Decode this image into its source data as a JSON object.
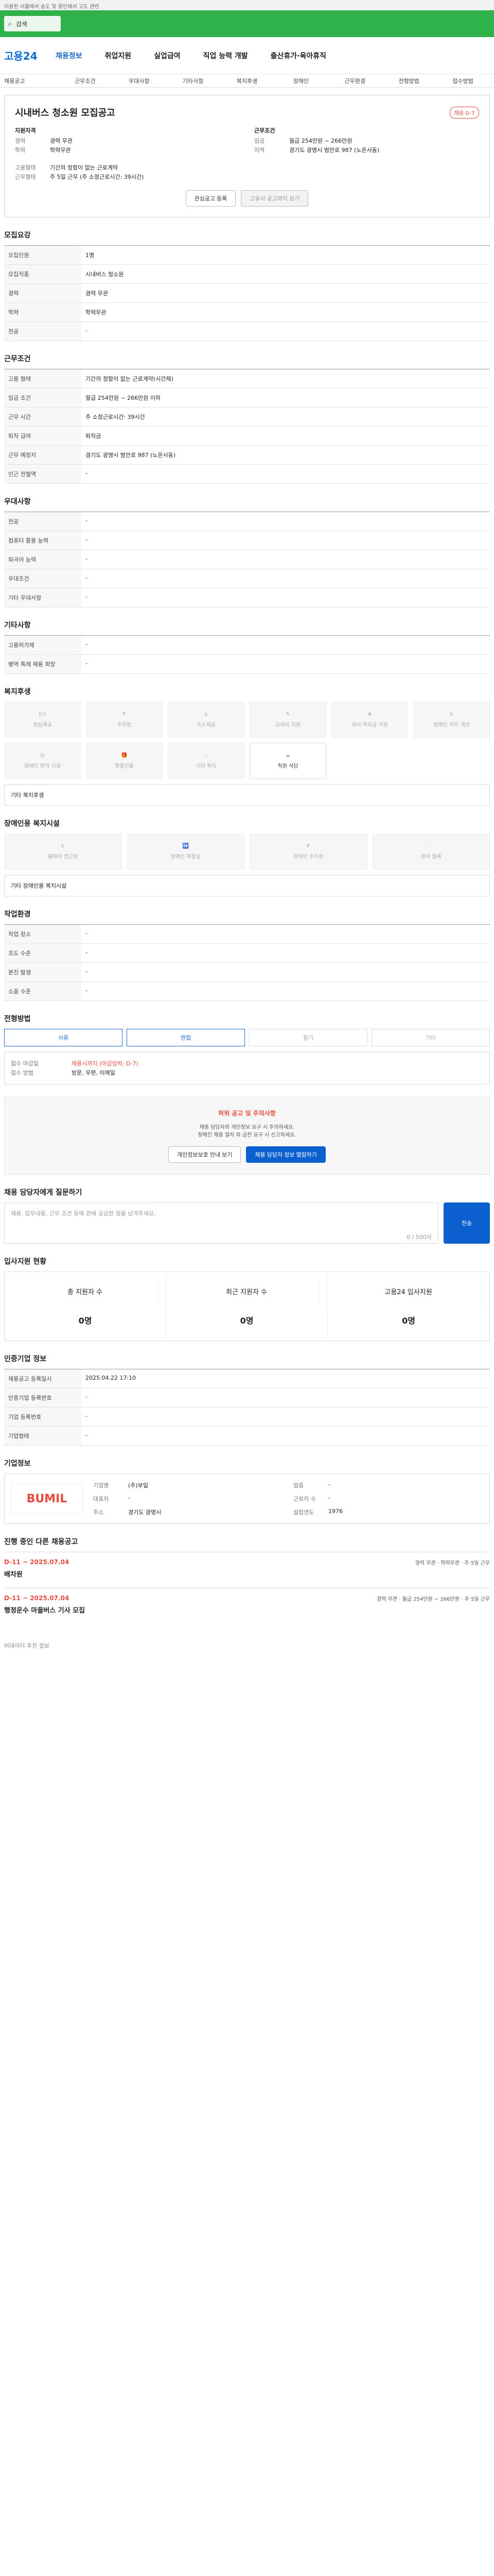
{
  "topbar": {
    "text": "이용된 서울에서 송도 및 용인에서 고도 관련"
  },
  "search": {
    "placeholder": "검색"
  },
  "header": {
    "logo": "고용24",
    "nav": [
      "채용정보",
      "취업지원",
      "실업급여",
      "직업 능력 개발",
      "출산휴가·육아휴직"
    ]
  },
  "subnav": [
    "채용공고",
    "근무조건",
    "우대사항",
    "기타사항",
    "복지후생",
    "장애인",
    "근무환경",
    "전형방법",
    "접수방법"
  ],
  "job": {
    "title": "시내버스 청소원 모집공고",
    "badge": "채용 D-7",
    "summary": {
      "left_label": "지원자격",
      "right_label": "근무조건",
      "rows": [
        {
          "k": "경력",
          "v": "경력 무관"
        },
        {
          "k": "학력",
          "v": "학력무관"
        },
        {
          "k": "임금",
          "v": "월급 254만원 ~ 266만원"
        },
        {
          "k": "지역",
          "v": "경기도 광명시 범안로 987 (노온사동)"
        },
        {
          "k": "고용형태",
          "v": "기간의 정함이 없는 근로계약"
        },
        {
          "k": "근무형태",
          "v": "주 5일 근무 (주 소정근로시간: 39시간)"
        }
      ]
    },
    "actions": [
      "관심공고 등록",
      "고유사 공고까지 보기"
    ]
  },
  "recruit": {
    "title": "모집요강",
    "rows": [
      {
        "k": "모집인원",
        "v": "1명"
      },
      {
        "k": "모집직종",
        "v": "시내버스 청소원"
      },
      {
        "k": "경력",
        "v": "경력 무관"
      },
      {
        "k": "학력",
        "v": "학력무관"
      },
      {
        "k": "전공",
        "v": "-"
      }
    ]
  },
  "work": {
    "title": "근무조건",
    "rows": [
      {
        "k": "고용 형태",
        "v": "기간의 정함이 없는 근로계약(시간제)"
      },
      {
        "k": "임금 조건",
        "v": "월급 254만원 ~ 266만원 이하"
      },
      {
        "k": "근무 시간",
        "v": "주 소정근로시간: 39시간"
      },
      {
        "k": "퇴직 급여",
        "v": "퇴직금"
      },
      {
        "k": "근무 예정지",
        "v": "경기도 광명시 범안로 987 (노온사동)"
      },
      {
        "k": "인근 전철역",
        "v": "-"
      }
    ]
  },
  "pref": {
    "title": "우대사항",
    "rows": [
      {
        "k": "전공",
        "v": "-"
      },
      {
        "k": "컴퓨터 활용 능력",
        "v": "-"
      },
      {
        "k": "외국어 능력",
        "v": "-"
      },
      {
        "k": "우대조건",
        "v": "-"
      },
      {
        "k": "기타 우대사항",
        "v": "-"
      }
    ]
  },
  "etc": {
    "title": "기타사항",
    "rows": [
      {
        "k": "고용허가제",
        "v": "-"
      },
      {
        "k": "병역 특례 채용 희망",
        "v": "-"
      }
    ]
  },
  "welfare": {
    "title": "복지후생",
    "items": [
      "점심제공",
      "주차장",
      "숙소제공",
      "교육비 지원",
      "자녀 학자금 지원",
      "장애인 처우 개선",
      "장애인 편의 시설",
      "명절선물",
      "기타 복지",
      "직원 식당"
    ],
    "note": "기타 복지후생"
  },
  "disability": {
    "title": "장애인용 복지시설",
    "items": [
      "휠체어 접근성",
      "장애인 화장실",
      "장애인 주차장",
      "점자 블록"
    ],
    "note": "기타 장애인용 복지시설"
  },
  "env": {
    "title": "작업환경",
    "rows": [
      {
        "k": "작업 장소",
        "v": "-"
      },
      {
        "k": "조도 수준",
        "v": "-"
      },
      {
        "k": "분진 발생",
        "v": "-"
      },
      {
        "k": "소음 수준",
        "v": "-"
      }
    ]
  },
  "method": {
    "title": "전형방법",
    "tabs": [
      "서류",
      "면접",
      "필기",
      "기타"
    ]
  },
  "apply": {
    "title": "접수방법",
    "deadline_label": "접수 마감일",
    "deadline": "채용시까지 (마감임박: D-7)",
    "method_label": "접수 방법",
    "method": "방문, 우편, 이메일"
  },
  "alert": {
    "title": "허위 공고 및 주의사항",
    "lines": [
      "채용 담당자와 개인정보 요구 시 주의하세요.",
      "정해진 채용 절차 외 금전 요구 시 신고하세요."
    ],
    "buttons": [
      "개인정보보호 안내 보기",
      "채용 담당자 정보 열람하기"
    ]
  },
  "contact": {
    "title": "채용 담당자에게 질문하기",
    "placeholder": "채용, 업무내용, 근무 조건 등에 관해 궁금한 점을 남겨주세요.",
    "counter": "0 / 500자",
    "submit": "전송"
  },
  "stats": {
    "title": "입사지원 현황",
    "items": [
      {
        "label": "총 지원자 수",
        "value": "0명"
      },
      {
        "label": "최근 지원자 수",
        "value": "0명"
      },
      {
        "label": "고용24 입사지원",
        "value": "0명"
      }
    ]
  },
  "info": {
    "title": "인증기업 정보",
    "rows": [
      {
        "k": "채용공고 등록일시",
        "v": "2025.04.22 17:10"
      },
      {
        "k": "인증기업 등록번호",
        "v": "-"
      },
      {
        "k": "기업 등록번호",
        "v": "-"
      },
      {
        "k": "기업형태",
        "v": "-"
      }
    ]
  },
  "company": {
    "title": "기업정보",
    "logo": "BUMIL",
    "rows": [
      {
        "k": "기업명",
        "v": "(주)부일"
      },
      {
        "k": "업종",
        "v": "-"
      },
      {
        "k": "대표자",
        "v": "-"
      },
      {
        "k": "근로자 수",
        "v": "-"
      },
      {
        "k": "주소",
        "v": "경기도 광명시"
      },
      {
        "k": "설립연도",
        "v": "1976"
      }
    ]
  },
  "related": {
    "title": "진행 중인 다른 채용공고",
    "jobs": [
      {
        "d": "D-11 ~ 2025.07.04",
        "title": "배차원",
        "tags": "경력 무관 · 학력무관 · 주 5일 근무"
      },
      {
        "d": "D-11 ~ 2025.07.04",
        "title": "행정운수 마을버스 기사 모집",
        "tags": "경력 무관 · 월급 254만원 ~ 266만원 · 주 5일 근무"
      }
    ]
  },
  "footer": {
    "title": "비대이터 추천 정보"
  }
}
